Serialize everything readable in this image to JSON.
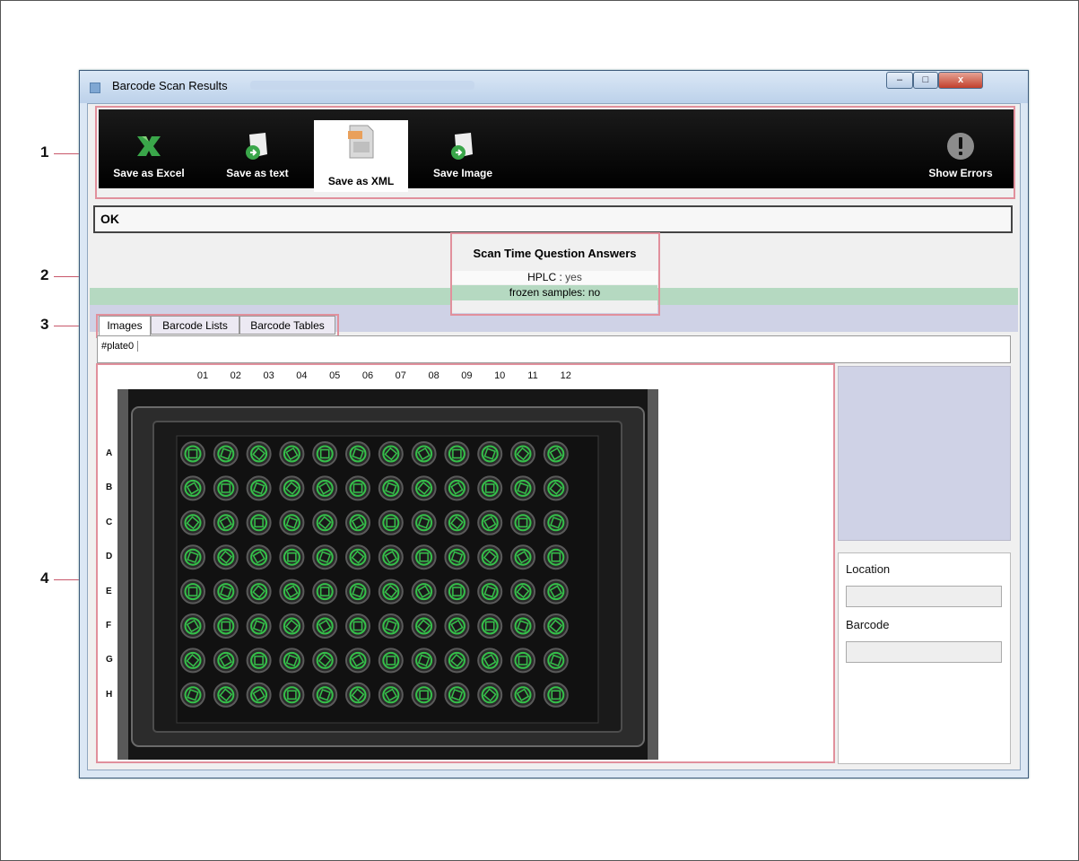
{
  "window": {
    "title": "Barcode Scan Results",
    "controls": {
      "minimize": "–",
      "maximize": "□",
      "close": "x"
    }
  },
  "toolbar": {
    "save_excel": "Save as Excel",
    "save_text": "Save as text",
    "save_xml": "Save as XML",
    "save_image": "Save Image",
    "show_errors": "Show Errors"
  },
  "status": {
    "text": "OK"
  },
  "scan_questions": {
    "title": "Scan Time Question Answers",
    "answers": [
      {
        "question": "HPLC :",
        "answer": "yes"
      },
      {
        "question": "frozen samples:",
        "answer": "no"
      }
    ]
  },
  "tabs": [
    "Images",
    "Barcode Lists",
    "Barcode Tables"
  ],
  "plate_tab": "#plate0",
  "plate": {
    "columns": [
      "01",
      "02",
      "03",
      "04",
      "05",
      "06",
      "07",
      "08",
      "09",
      "10",
      "11",
      "12"
    ],
    "rows": [
      "A",
      "B",
      "C",
      "D",
      "E",
      "F",
      "G",
      "H"
    ]
  },
  "details": {
    "location_label": "Location",
    "barcode_label": "Barcode"
  },
  "callouts": [
    "1",
    "2",
    "3",
    "4"
  ],
  "colors": {
    "accent_callout": "#e1909c",
    "well_green": "#35c04a",
    "status_green": "#b5d9c1",
    "lilac": "#cfd2e6"
  }
}
